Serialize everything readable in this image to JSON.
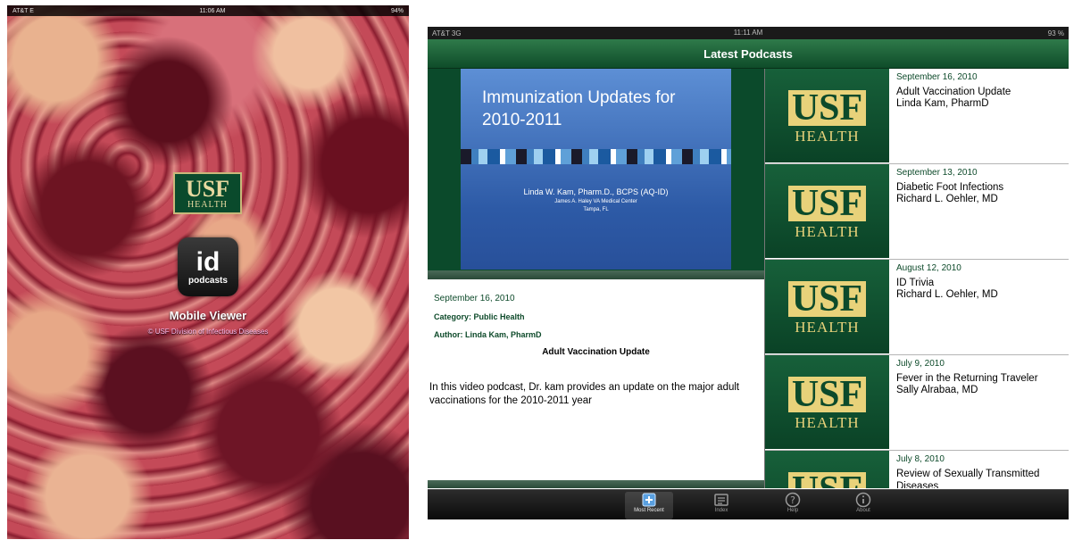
{
  "splash": {
    "status": {
      "carrier": "AT&T E",
      "time": "11:06 AM",
      "battery": "94%"
    },
    "logo": {
      "usf": "USF",
      "health": "HEALTH"
    },
    "app_icon": {
      "line1": "id",
      "line2": "podcasts"
    },
    "subtitle": "Mobile Viewer",
    "copyright": "© USF Division of Infectious Diseases"
  },
  "app": {
    "status": {
      "carrier": "AT&T 3G",
      "time": "11:11 AM",
      "battery": "93 %"
    },
    "title": "Latest Podcasts",
    "slide": {
      "title": "Immunization Updates for 2010-2011",
      "author": "Linda W. Kam, Pharm.D., BCPS (AQ-ID)",
      "affiliation1": "James A. Haley VA Medical Center",
      "affiliation2": "Tampa, FL"
    },
    "detail": {
      "date": "September 16, 2010",
      "category": "Category: Public Health",
      "author": "Author: Linda Kam, PharmD",
      "title": "Adult Vaccination Update",
      "description": "In this video podcast, Dr. kam provides an update on the major adult vaccinations for the 2010-2011 year"
    },
    "podcasts": [
      {
        "date": "September 16, 2010",
        "title": "Adult Vaccination Update",
        "speaker": "Linda Kam, PharmD"
      },
      {
        "date": "September 13, 2010",
        "title": "Diabetic Foot Infections",
        "speaker": "Richard L. Oehler, MD"
      },
      {
        "date": "August 12, 2010",
        "title": "ID Trivia",
        "speaker": "Richard L. Oehler, MD"
      },
      {
        "date": "July 9, 2010",
        "title": "Fever in the Returning Traveler",
        "speaker": "Sally Alrabaa, MD"
      },
      {
        "date": "July 8, 2010",
        "title": "Review of Sexually Transmitted Diseases",
        "speaker": ""
      }
    ],
    "tabs": [
      {
        "label": "Most Recent",
        "icon": "most-recent-icon"
      },
      {
        "label": "Index",
        "icon": "index-icon"
      },
      {
        "label": "Help",
        "icon": "help-icon"
      },
      {
        "label": "About",
        "icon": "about-icon"
      }
    ],
    "colors": {
      "usf_green": "#0b4a2b",
      "usf_gold": "#e8d27a",
      "slide_blue": "#2d5aa6"
    }
  }
}
